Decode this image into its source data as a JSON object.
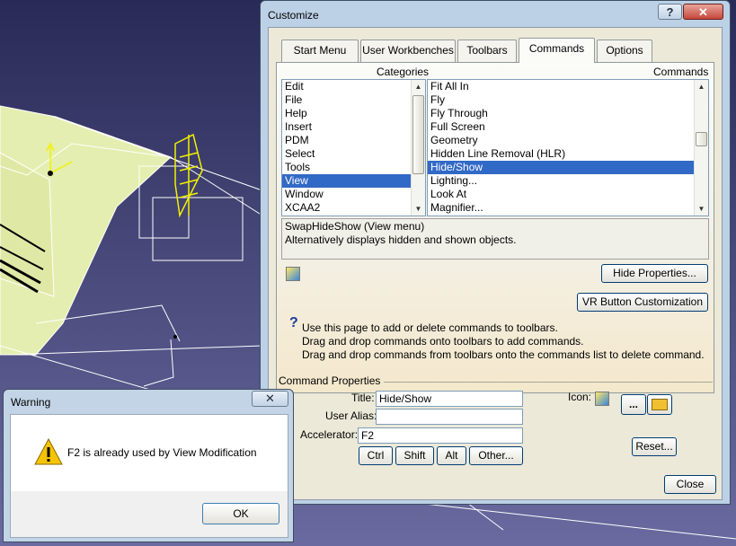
{
  "customize": {
    "title": "Customize",
    "help_btn": "?",
    "close_btn": "✕",
    "tabs": [
      {
        "label": "Start Menu",
        "active": false
      },
      {
        "label": "User Workbenches",
        "active": false
      },
      {
        "label": "Toolbars",
        "active": false
      },
      {
        "label": "Commands",
        "active": true
      },
      {
        "label": "Options",
        "active": false
      }
    ],
    "categories_label": "Categories",
    "commands_label": "Commands",
    "categories": [
      "Edit",
      "File",
      "Help",
      "Insert",
      "PDM",
      "Select",
      "Tools",
      "View",
      "Window",
      "XCAA2"
    ],
    "selected_category": "View",
    "commands": [
      "Fit All In",
      "Fly",
      "Fly Through",
      "Full Screen",
      "Geometry",
      "Hidden Line Removal (HLR)",
      "Hide/Show",
      "Lighting...",
      "Look At",
      "Magnifier..."
    ],
    "selected_command": "Hide/Show",
    "description_line1": "SwapHideShow (View menu)",
    "description_line2": "Alternatively displays hidden and shown objects.",
    "hide_properties_btn": "Hide Properties...",
    "vr_button": "VR Button Customization",
    "help_lines": [
      "Use this page to add or delete commands to toolbars.",
      "Drag and drop commands onto toolbars to add commands.",
      "Drag and drop commands from toolbars onto the commands list to delete command."
    ],
    "command_properties_label": "Command Properties",
    "title_label": "Title:",
    "title_value": "Hide/Show",
    "user_alias_label": "User Alias:",
    "user_alias_value": "",
    "accelerator_label": "Accelerator:",
    "accelerator_value": "F2",
    "ctrl_btn": "Ctrl",
    "shift_btn": "Shift",
    "alt_btn": "Alt",
    "other_btn": "Other...",
    "icon_label": "Icon:",
    "browse_btn": "...",
    "reset_btn": "Reset...",
    "close_button": "Close"
  },
  "warning": {
    "title": "Warning",
    "close_btn": "✕",
    "message": "F2 is already used by View Modification",
    "ok_btn": "OK"
  },
  "colors": {
    "selection": "#3169c6",
    "viewport_bg": "#3e3e6e",
    "model_fill": "#e6f0b0",
    "highlight_yellow": "#f2f200"
  }
}
